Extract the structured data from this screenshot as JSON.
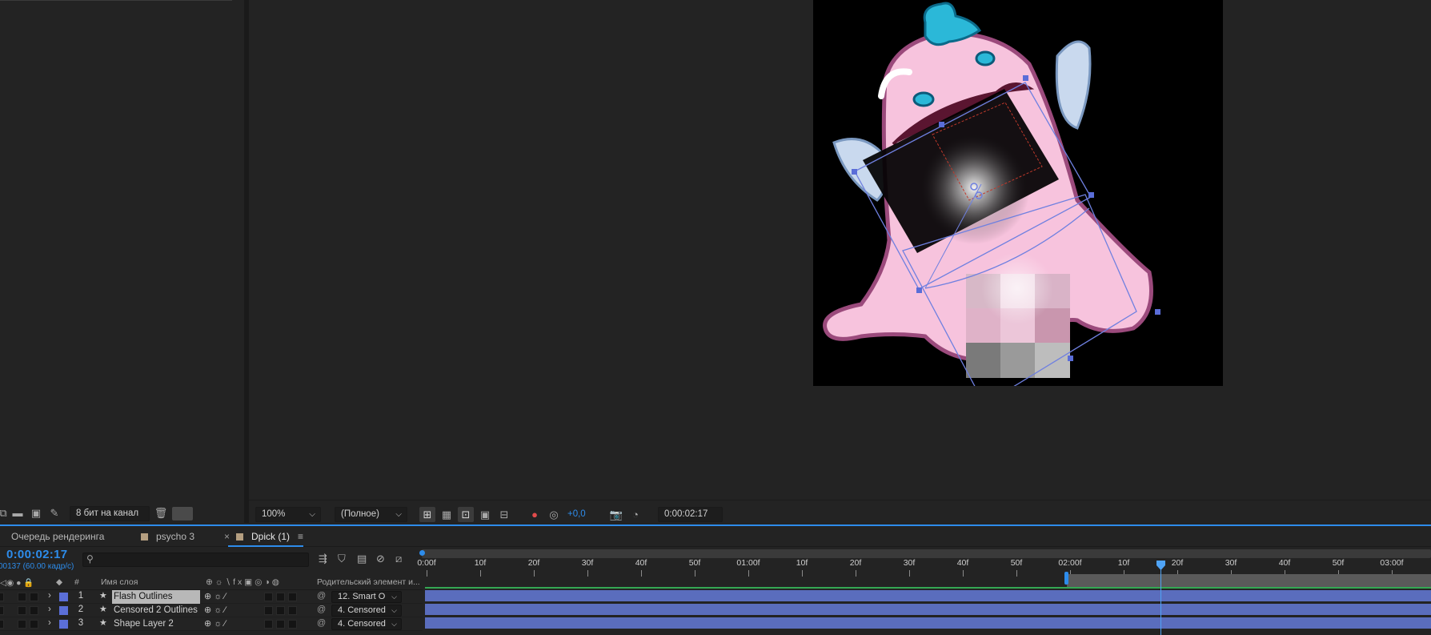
{
  "project_toolbar": {
    "bit_depth": "8 бит на канал"
  },
  "viewer_toolbar": {
    "zoom": "100%",
    "resolution": "(Полное)",
    "exposure": "+0,0",
    "timecode": "0:00:02:17"
  },
  "tabs": [
    {
      "label": "Очередь рендеринга"
    },
    {
      "label": "psycho 3"
    },
    {
      "label": "Dpick (1)",
      "active": true
    }
  ],
  "timeline": {
    "current_time": "0:00:02:17",
    "fps_info": "00137 (60.00 кадр/с)",
    "columns": {
      "hash": "#",
      "layer_name": "Имя слоя",
      "parent": "Родительский элемент и..."
    },
    "ruler": [
      "0:00f",
      "10f",
      "20f",
      "30f",
      "40f",
      "50f",
      "01:00f",
      "10f",
      "20f",
      "30f",
      "40f",
      "50f",
      "02:00f",
      "10f",
      "20f",
      "30f",
      "40f",
      "50f",
      "03:00f"
    ],
    "layers": [
      {
        "num": "1",
        "name": "Flash Outlines",
        "parent": "12. Smart O",
        "selected": true
      },
      {
        "num": "2",
        "name": "Censored 2 Outlines",
        "parent": "4. Censored"
      },
      {
        "num": "3",
        "name": "Shape Layer 2",
        "parent": "4. Censored"
      }
    ]
  },
  "colors": {
    "accent_blue": "#2d8ceb",
    "label_blue": "#5b6fd8",
    "bar_blue": "#5a6dbd",
    "panel_bg": "#232323",
    "character_pink": "#f7c3dd",
    "character_outline": "#9b4a7c",
    "hair_cyan": "#2bb8d8"
  }
}
